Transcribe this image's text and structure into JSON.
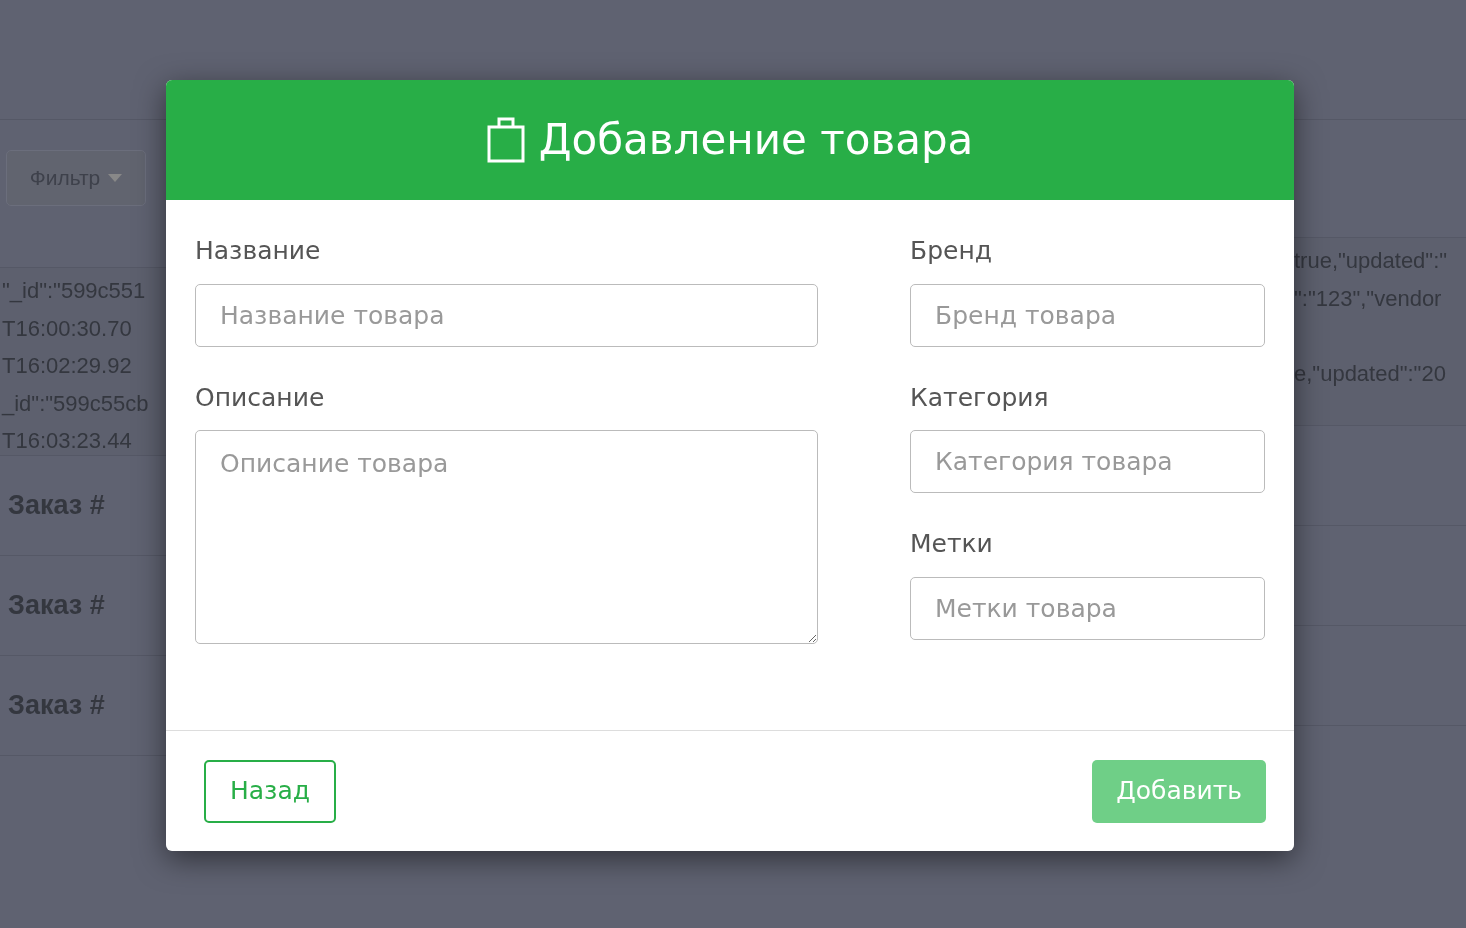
{
  "background": {
    "filter_button": {
      "label": "Фильтр"
    },
    "code_left": [
      "\"_id\":\"599c551",
      "T16:00:30.70",
      "T16:02:29.92",
      "_id\":\"599c55cb",
      "T16:03:23.44"
    ],
    "code_right": [
      [
        "true,\"updated\":\"",
        "\":\"123\",\"vendor"
      ],
      [
        "e,\"updated\":\"20"
      ]
    ],
    "orders": [
      "Заказ #",
      "Заказ #",
      "Заказ #"
    ]
  },
  "modal": {
    "title": "Добавление товара",
    "left_fields": [
      {
        "label": "Название",
        "placeholder": "Название товара",
        "kind": "input"
      },
      {
        "label": "Описание",
        "placeholder": "Описание товара",
        "kind": "textarea"
      }
    ],
    "right_fields": [
      {
        "label": "Бренд",
        "placeholder": "Бренд товара",
        "kind": "input"
      },
      {
        "label": "Категория",
        "placeholder": "Категория товара",
        "kind": "input"
      },
      {
        "label": "Метки",
        "placeholder": "Метки товара",
        "kind": "input"
      }
    ],
    "back_button": {
      "label": "Назад"
    },
    "submit_button": {
      "label": "Добавить",
      "disabled": true
    }
  }
}
